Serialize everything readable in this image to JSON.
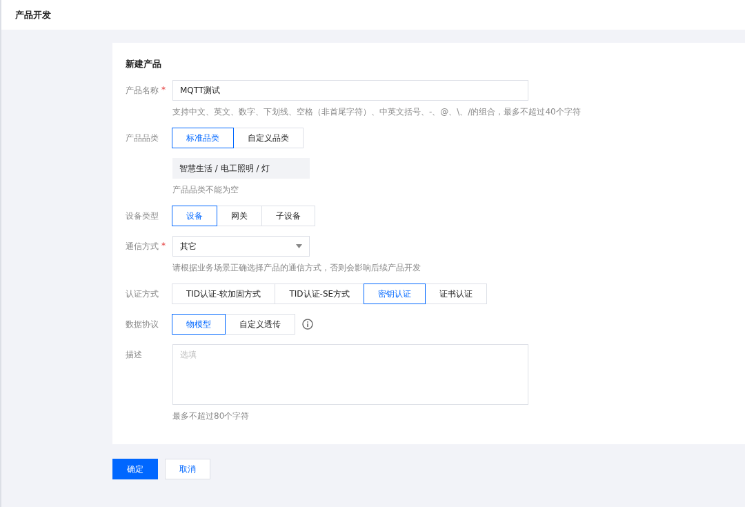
{
  "header": {
    "title": "产品开发"
  },
  "form": {
    "title": "新建产品",
    "fields": [
      {
        "kind": "input",
        "label": "产品名称",
        "required_mark": "*",
        "value": "MQTT测试",
        "hint": "支持中文、英文、数字、下划线、空格（非首尾字符）、中英文括号、-、@、\\、/的组合，最多不超过40个字符"
      },
      {
        "kind": "segmented",
        "label": "产品品类",
        "options": [
          {
            "label": "标准品类",
            "selected": true
          },
          {
            "label": "自定义品类",
            "selected": false
          }
        ],
        "category": "智慧生活 / 电工照明 / 灯",
        "hint": "产品品类不能为空"
      },
      {
        "kind": "segmented",
        "label": "设备类型",
        "options": [
          {
            "label": "设备",
            "selected": true
          },
          {
            "label": "网关",
            "selected": false
          },
          {
            "label": "子设备",
            "selected": false
          }
        ]
      },
      {
        "kind": "select",
        "label": "通信方式",
        "required_mark": "*",
        "value": "其它",
        "hint": "请根据业务场景正确选择产品的通信方式，否则会影响后续产品开发"
      },
      {
        "kind": "segmented",
        "label": "认证方式",
        "options": [
          {
            "label": "TID认证-软加固方式",
            "selected": false
          },
          {
            "label": "TID认证-SE方式",
            "selected": false
          },
          {
            "label": "密钥认证",
            "selected": true
          },
          {
            "label": "证书认证",
            "selected": false
          }
        ]
      },
      {
        "kind": "segmented",
        "label": "数据协议",
        "info": true,
        "options": [
          {
            "label": "物模型",
            "selected": true
          },
          {
            "label": "自定义透传",
            "selected": false
          }
        ]
      },
      {
        "kind": "textarea",
        "label": "描述",
        "placeholder": "选填",
        "hint": "最多不超过80个字符"
      }
    ]
  },
  "buttons": [
    {
      "label": "确定",
      "kind": "primary"
    },
    {
      "label": "取消",
      "kind": "default"
    }
  ]
}
